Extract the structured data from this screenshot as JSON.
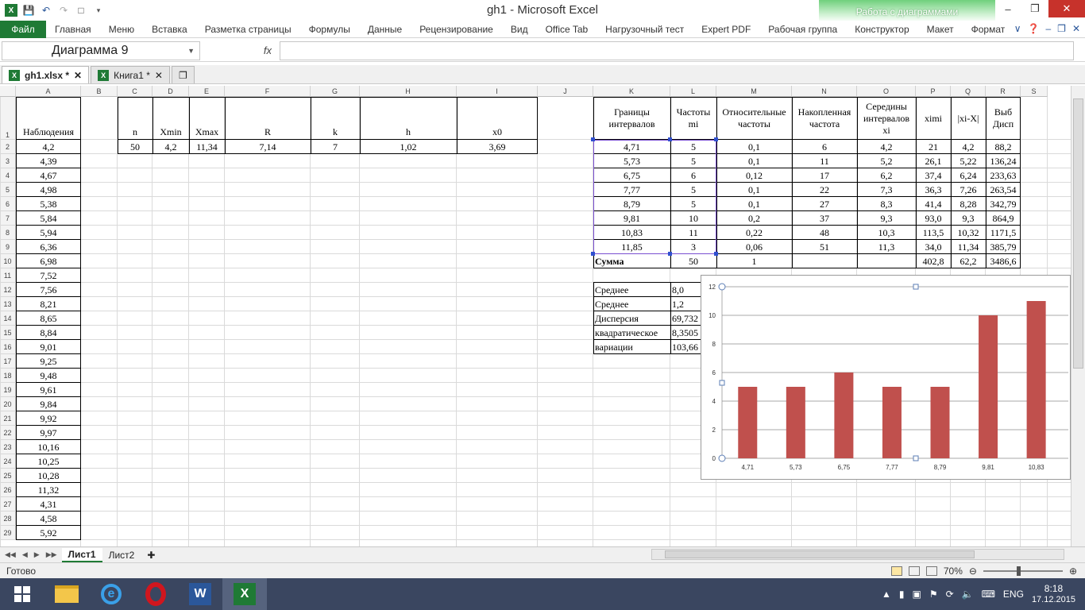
{
  "window": {
    "title": "gh1 - Microsoft Excel",
    "context_tab": "Работа с диаграммами"
  },
  "ribbon": {
    "file_label": "Файл",
    "tabs": [
      "Главная",
      "Меню",
      "Вставка",
      "Разметка страницы",
      "Формулы",
      "Данные",
      "Рецензирование",
      "Вид",
      "Office Tab",
      "Нагрузочный тест",
      "Expert PDF",
      "Рабочая группа",
      "Конструктор",
      "Макет",
      "Формат"
    ]
  },
  "formula_bar": {
    "name_box": "Диаграмма 9",
    "fx": "fx",
    "value": ""
  },
  "doc_tabs": [
    {
      "label": "gh1.xlsx *",
      "active": true
    },
    {
      "label": "Книга1 *",
      "active": false
    }
  ],
  "columns": [
    "A",
    "B",
    "C",
    "D",
    "E",
    "F",
    "G",
    "H",
    "I",
    "J",
    "K",
    "L",
    "M",
    "N",
    "O",
    "P",
    "Q",
    "R",
    "S"
  ],
  "rows": [
    "1",
    "2",
    "3",
    "4",
    "5",
    "6",
    "7",
    "8",
    "9",
    "10",
    "11",
    "12",
    "13",
    "14",
    "15",
    "16",
    "17",
    "18",
    "19",
    "20",
    "21",
    "22",
    "23",
    "24",
    "25",
    "26",
    "27",
    "28",
    "29"
  ],
  "observations": {
    "header": "Наблюдения",
    "values": [
      "4,2",
      "4,39",
      "4,67",
      "4,98",
      "5,38",
      "5,84",
      "5,94",
      "6,36",
      "6,98",
      "7,52",
      "7,56",
      "8,21",
      "8,65",
      "8,84",
      "9,01",
      "9,25",
      "9,48",
      "9,61",
      "9,84",
      "9,92",
      "9,97",
      "10,16",
      "10,25",
      "10,28",
      "11,32",
      "4,31",
      "4,58",
      "5,92"
    ]
  },
  "params": {
    "headers": [
      "n",
      "Xmin",
      "Xmax",
      "R",
      "k",
      "h",
      "x0"
    ],
    "values": [
      "50",
      "4,2",
      "11,34",
      "7,14",
      "7",
      "1,02",
      "3,69"
    ]
  },
  "freq_table": {
    "headers": [
      "Границы интервалов",
      "Частоты mi",
      "Относительные частоты",
      "Накопленная частота",
      "Середины интервалов xi",
      "ximi",
      "|xi-X|",
      "Выб Дисп"
    ],
    "rows": [
      [
        "4,71",
        "5",
        "0,1",
        "6",
        "4,2",
        "21",
        "4,2",
        "88,2"
      ],
      [
        "5,73",
        "5",
        "0,1",
        "11",
        "5,2",
        "26,1",
        "5,22",
        "136,24"
      ],
      [
        "6,75",
        "6",
        "0,12",
        "17",
        "6,2",
        "37,4",
        "6,24",
        "233,63"
      ],
      [
        "7,77",
        "5",
        "0,1",
        "22",
        "7,3",
        "36,3",
        "7,26",
        "263,54"
      ],
      [
        "8,79",
        "5",
        "0,1",
        "27",
        "8,3",
        "41,4",
        "8,28",
        "342,79"
      ],
      [
        "9,81",
        "10",
        "0,2",
        "37",
        "9,3",
        "93,0",
        "9,3",
        "864,9"
      ],
      [
        "10,83",
        "11",
        "0,22",
        "48",
        "10,3",
        "113,5",
        "10,32",
        "1171,5"
      ],
      [
        "11,85",
        "3",
        "0,06",
        "51",
        "11,3",
        "34,0",
        "11,34",
        "385,79"
      ]
    ],
    "sum_row": [
      "Сумма",
      "50",
      "1",
      "",
      "",
      "402,8",
      "62,2",
      "3486,6"
    ]
  },
  "stats": [
    {
      "label": "Среднее",
      "value": "8,0"
    },
    {
      "label": "Среднее",
      "value": "1,2"
    },
    {
      "label": "Дисперсия",
      "value": "69,732"
    },
    {
      "label": "квадратическое",
      "value": "8,3505"
    },
    {
      "label": "вариации",
      "value": "103,66"
    }
  ],
  "chart_data": {
    "type": "bar",
    "categories": [
      "4,71",
      "5,73",
      "6,75",
      "7,77",
      "8,79",
      "9,81",
      "10,83"
    ],
    "values": [
      5,
      5,
      6,
      5,
      5,
      10,
      11
    ],
    "ylim": [
      0,
      12
    ],
    "yticks": [
      "0",
      "2",
      "4",
      "6",
      "8",
      "10",
      "12"
    ],
    "grid": true,
    "bar_color": "#c0504d"
  },
  "sheets": [
    "Лист1",
    "Лист2"
  ],
  "status": {
    "ready": "Готово",
    "zoom": "70%"
  },
  "taskbar": {
    "lang": "ENG",
    "time": "8:18",
    "date": "17.12.2015"
  },
  "colors": {
    "excel_green": "#1f7a35",
    "bar": "#c0504d",
    "taskbar": "#3a4660"
  }
}
